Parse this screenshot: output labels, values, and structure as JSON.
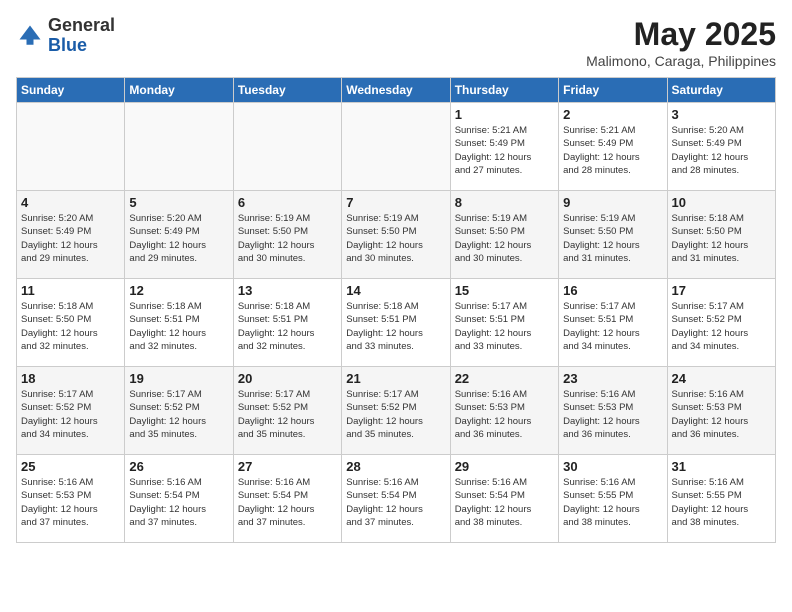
{
  "logo": {
    "general": "General",
    "blue": "Blue"
  },
  "title": {
    "month_year": "May 2025",
    "location": "Malimono, Caraga, Philippines"
  },
  "weekdays": [
    "Sunday",
    "Monday",
    "Tuesday",
    "Wednesday",
    "Thursday",
    "Friday",
    "Saturday"
  ],
  "weeks": [
    [
      {
        "day": "",
        "info": ""
      },
      {
        "day": "",
        "info": ""
      },
      {
        "day": "",
        "info": ""
      },
      {
        "day": "",
        "info": ""
      },
      {
        "day": "1",
        "info": "Sunrise: 5:21 AM\nSunset: 5:49 PM\nDaylight: 12 hours\nand 27 minutes."
      },
      {
        "day": "2",
        "info": "Sunrise: 5:21 AM\nSunset: 5:49 PM\nDaylight: 12 hours\nand 28 minutes."
      },
      {
        "day": "3",
        "info": "Sunrise: 5:20 AM\nSunset: 5:49 PM\nDaylight: 12 hours\nand 28 minutes."
      }
    ],
    [
      {
        "day": "4",
        "info": "Sunrise: 5:20 AM\nSunset: 5:49 PM\nDaylight: 12 hours\nand 29 minutes."
      },
      {
        "day": "5",
        "info": "Sunrise: 5:20 AM\nSunset: 5:49 PM\nDaylight: 12 hours\nand 29 minutes."
      },
      {
        "day": "6",
        "info": "Sunrise: 5:19 AM\nSunset: 5:50 PM\nDaylight: 12 hours\nand 30 minutes."
      },
      {
        "day": "7",
        "info": "Sunrise: 5:19 AM\nSunset: 5:50 PM\nDaylight: 12 hours\nand 30 minutes."
      },
      {
        "day": "8",
        "info": "Sunrise: 5:19 AM\nSunset: 5:50 PM\nDaylight: 12 hours\nand 30 minutes."
      },
      {
        "day": "9",
        "info": "Sunrise: 5:19 AM\nSunset: 5:50 PM\nDaylight: 12 hours\nand 31 minutes."
      },
      {
        "day": "10",
        "info": "Sunrise: 5:18 AM\nSunset: 5:50 PM\nDaylight: 12 hours\nand 31 minutes."
      }
    ],
    [
      {
        "day": "11",
        "info": "Sunrise: 5:18 AM\nSunset: 5:50 PM\nDaylight: 12 hours\nand 32 minutes."
      },
      {
        "day": "12",
        "info": "Sunrise: 5:18 AM\nSunset: 5:51 PM\nDaylight: 12 hours\nand 32 minutes."
      },
      {
        "day": "13",
        "info": "Sunrise: 5:18 AM\nSunset: 5:51 PM\nDaylight: 12 hours\nand 32 minutes."
      },
      {
        "day": "14",
        "info": "Sunrise: 5:18 AM\nSunset: 5:51 PM\nDaylight: 12 hours\nand 33 minutes."
      },
      {
        "day": "15",
        "info": "Sunrise: 5:17 AM\nSunset: 5:51 PM\nDaylight: 12 hours\nand 33 minutes."
      },
      {
        "day": "16",
        "info": "Sunrise: 5:17 AM\nSunset: 5:51 PM\nDaylight: 12 hours\nand 34 minutes."
      },
      {
        "day": "17",
        "info": "Sunrise: 5:17 AM\nSunset: 5:52 PM\nDaylight: 12 hours\nand 34 minutes."
      }
    ],
    [
      {
        "day": "18",
        "info": "Sunrise: 5:17 AM\nSunset: 5:52 PM\nDaylight: 12 hours\nand 34 minutes."
      },
      {
        "day": "19",
        "info": "Sunrise: 5:17 AM\nSunset: 5:52 PM\nDaylight: 12 hours\nand 35 minutes."
      },
      {
        "day": "20",
        "info": "Sunrise: 5:17 AM\nSunset: 5:52 PM\nDaylight: 12 hours\nand 35 minutes."
      },
      {
        "day": "21",
        "info": "Sunrise: 5:17 AM\nSunset: 5:52 PM\nDaylight: 12 hours\nand 35 minutes."
      },
      {
        "day": "22",
        "info": "Sunrise: 5:16 AM\nSunset: 5:53 PM\nDaylight: 12 hours\nand 36 minutes."
      },
      {
        "day": "23",
        "info": "Sunrise: 5:16 AM\nSunset: 5:53 PM\nDaylight: 12 hours\nand 36 minutes."
      },
      {
        "day": "24",
        "info": "Sunrise: 5:16 AM\nSunset: 5:53 PM\nDaylight: 12 hours\nand 36 minutes."
      }
    ],
    [
      {
        "day": "25",
        "info": "Sunrise: 5:16 AM\nSunset: 5:53 PM\nDaylight: 12 hours\nand 37 minutes."
      },
      {
        "day": "26",
        "info": "Sunrise: 5:16 AM\nSunset: 5:54 PM\nDaylight: 12 hours\nand 37 minutes."
      },
      {
        "day": "27",
        "info": "Sunrise: 5:16 AM\nSunset: 5:54 PM\nDaylight: 12 hours\nand 37 minutes."
      },
      {
        "day": "28",
        "info": "Sunrise: 5:16 AM\nSunset: 5:54 PM\nDaylight: 12 hours\nand 37 minutes."
      },
      {
        "day": "29",
        "info": "Sunrise: 5:16 AM\nSunset: 5:54 PM\nDaylight: 12 hours\nand 38 minutes."
      },
      {
        "day": "30",
        "info": "Sunrise: 5:16 AM\nSunset: 5:55 PM\nDaylight: 12 hours\nand 38 minutes."
      },
      {
        "day": "31",
        "info": "Sunrise: 5:16 AM\nSunset: 5:55 PM\nDaylight: 12 hours\nand 38 minutes."
      }
    ]
  ]
}
